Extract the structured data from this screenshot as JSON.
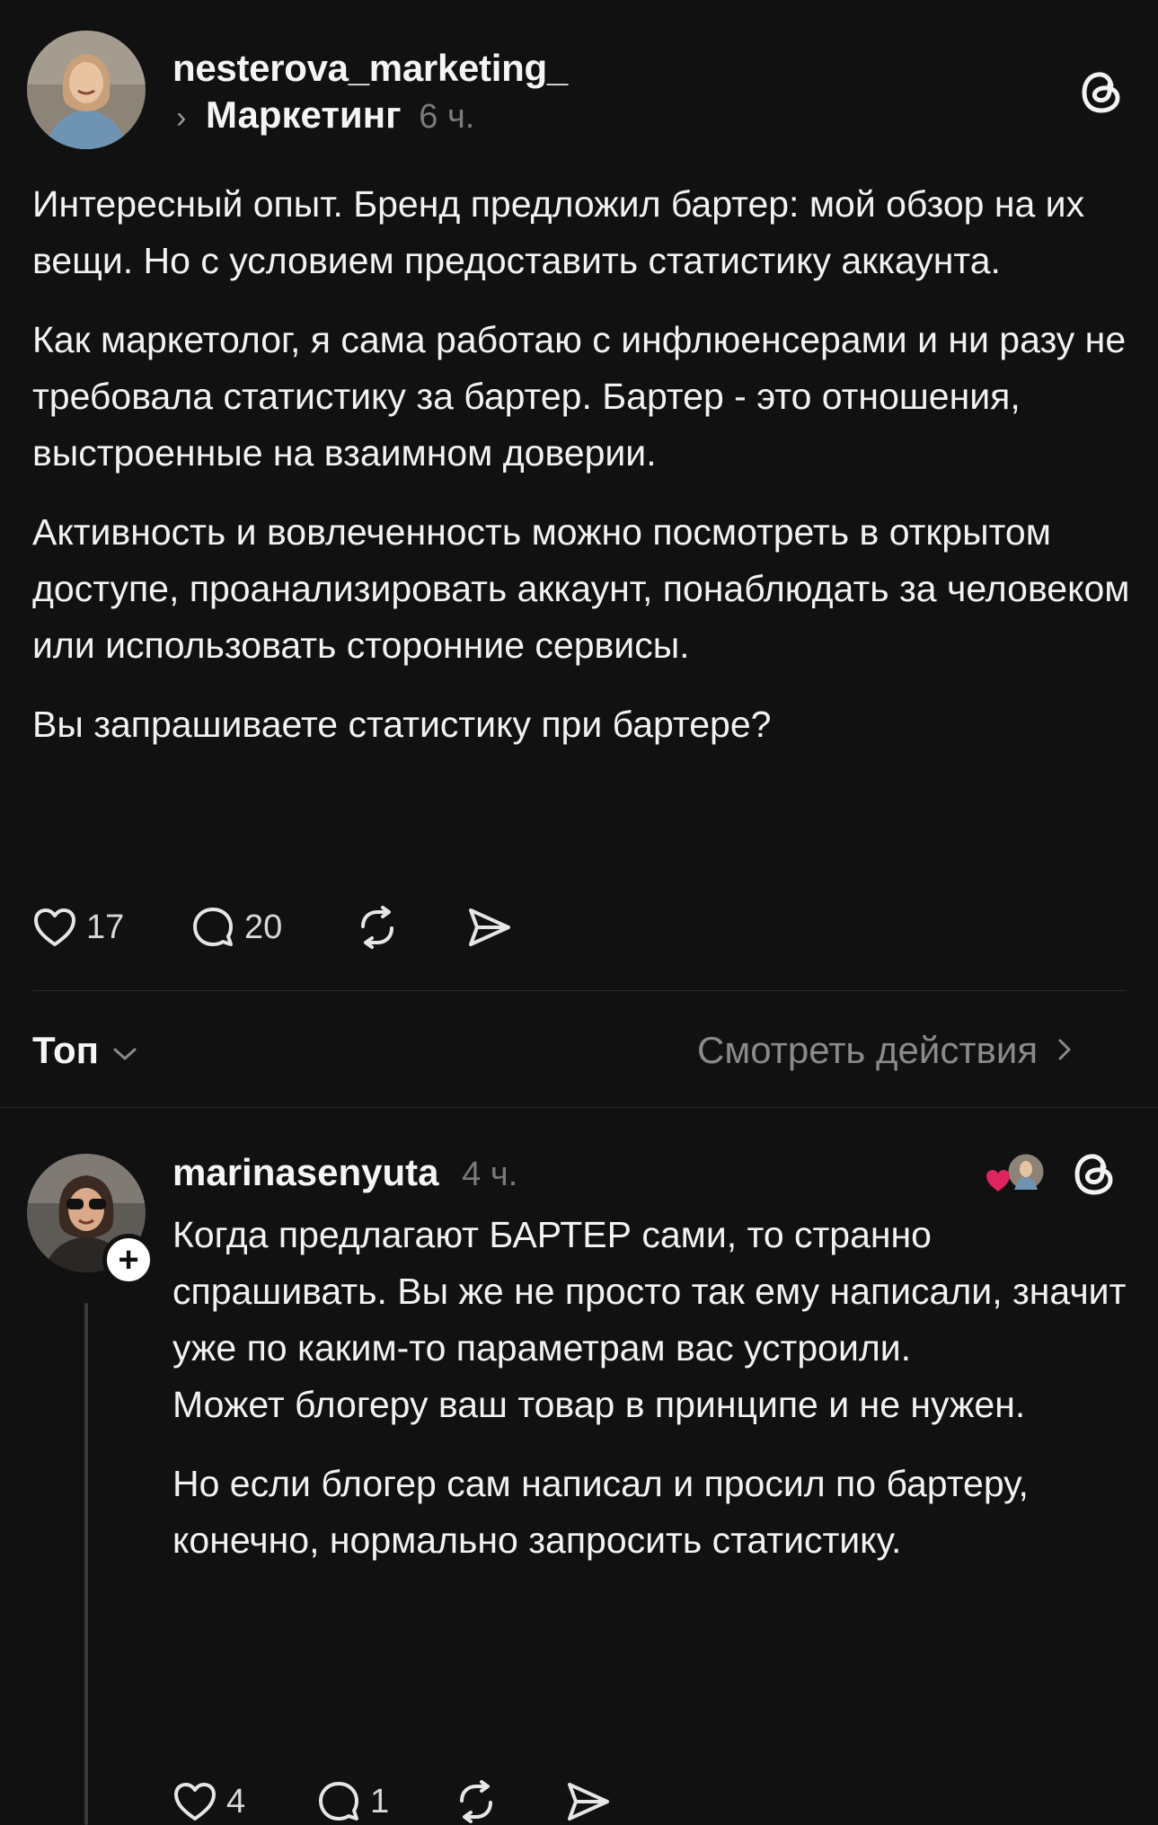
{
  "post": {
    "username": "nesterova_marketing_",
    "topic": "Маркетинг",
    "time": "6 ч.",
    "paragraphs": [
      "Интересный опыт. Бренд предложил бартер: мой обзор на их вещи. Но с условием предоставить статистику аккаунта.",
      "Как маркетолог, я сама работаю с инфлюенсерами и ни разу не требовала статистику за бартер. Бартер - это отношения, выстроенные на взаимном доверии.",
      "Активность и вовлеченность можно посмотреть в открытом доступе, проанализировать аккаунт, понаблюдать  за человеком или использовать сторонние сервисы.",
      "Вы запрашиваете статистику при бартере?"
    ],
    "likes": "17",
    "replies": "20"
  },
  "sort": {
    "label": "Топ",
    "view_activity": "Смотреть действия"
  },
  "reply": {
    "username": "marinasenyuta",
    "time": "4 ч.",
    "follow_symbol": "+",
    "paragraphs": [
      "Когда предлагают БАРТЕР сами, то странно спрашивать. Вы же не просто так ему написали, значит уже по каким-то параметрам вас устроили.",
      "Может блогеру ваш товар в принципе и не нужен.",
      "Но если блогер сам написал и просил по бартеру, конечно, нормально запросить статистику."
    ],
    "likes": "4",
    "replies": "1"
  },
  "colors": {
    "background": "#111111",
    "text": "#f2f2f2",
    "muted": "#8a8a8a",
    "like_heart": "#e0245e"
  }
}
